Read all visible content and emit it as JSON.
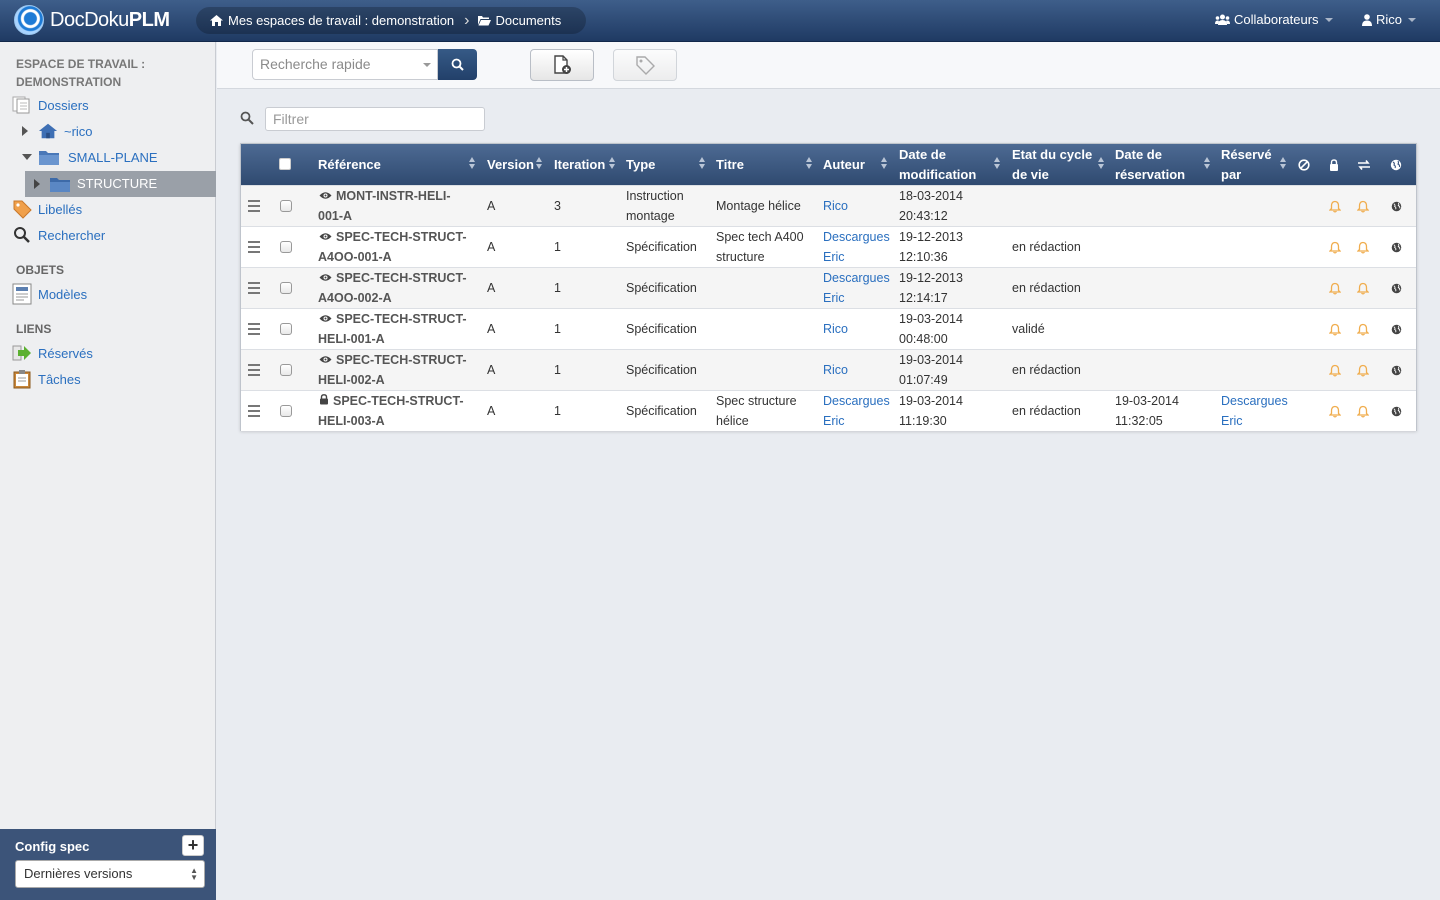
{
  "app": {
    "brand_plain": "DocDoku",
    "brand_bold": "PLM"
  },
  "breadcrumb": {
    "workspace": "Mes espaces de travail : demonstration",
    "documents": "Documents"
  },
  "navbar": {
    "collaborators": "Collaborateurs",
    "user": "Rico"
  },
  "sidebar": {
    "workspace_title": "ESPACE DE TRAVAIL : DEMONSTRATION",
    "folders": "Dossiers",
    "home_folder": "~rico",
    "small_plane": "SMALL-PLANE",
    "structure": "STRUCTURE",
    "tags": "Libellés",
    "search": "Rechercher",
    "objects_section": "OBJETS",
    "models": "Modèles",
    "links_section": "LIENS",
    "reserved": "Réservés",
    "tasks": "Tâches"
  },
  "config": {
    "title": "Config spec",
    "add": "+",
    "selected": "Dernières versions"
  },
  "toolbar": {
    "search_placeholder": "Recherche rapide"
  },
  "filter": {
    "placeholder": "Filtrer"
  },
  "table": {
    "headers": {
      "reference": "Référence",
      "version": "Version",
      "iteration": "Iteration",
      "type": "Type",
      "title": "Titre",
      "author": "Auteur",
      "modified_1": "Date de",
      "modified_2": "modification",
      "lifecycle_1": "Etat du cycle",
      "lifecycle_2": "de vie",
      "reservation_1": "Date de",
      "reservation_2": "réservation",
      "reserved_by_1": "Réservé",
      "reserved_by_2": "par"
    },
    "rows": [
      {
        "status_icon": "eye-icon",
        "ref1": "MONT-INSTR-HELI-",
        "ref2": "001-A",
        "version": "A",
        "iteration": "3",
        "type1": "Instruction",
        "type2": "montage",
        "title1": "Montage hélice",
        "title2": "",
        "author1": "Rico",
        "author2": "",
        "date1": "18-03-2014",
        "date2": "20:43:12",
        "state": "",
        "rdate1": "",
        "rdate2": "",
        "rby1": "",
        "rby2": ""
      },
      {
        "status_icon": "eye-icon",
        "ref1": "SPEC-TECH-STRUCT-",
        "ref2": "A4OO-001-A",
        "version": "A",
        "iteration": "1",
        "type1": "Spécification",
        "type2": "",
        "title1": "Spec tech A400",
        "title2": "structure",
        "author1": "Descargues",
        "author2": "Eric",
        "date1": "19-12-2013",
        "date2": "12:10:36",
        "state": "en rédaction",
        "rdate1": "",
        "rdate2": "",
        "rby1": "",
        "rby2": ""
      },
      {
        "status_icon": "eye-icon",
        "ref1": "SPEC-TECH-STRUCT-",
        "ref2": "A4OO-002-A",
        "version": "A",
        "iteration": "1",
        "type1": "Spécification",
        "type2": "",
        "title1": "",
        "title2": "",
        "author1": "Descargues",
        "author2": "Eric",
        "date1": "19-12-2013",
        "date2": "12:14:17",
        "state": "en rédaction",
        "rdate1": "",
        "rdate2": "",
        "rby1": "",
        "rby2": ""
      },
      {
        "status_icon": "eye-icon",
        "ref1": "SPEC-TECH-STRUCT-",
        "ref2": "HELI-001-A",
        "version": "A",
        "iteration": "1",
        "type1": "Spécification",
        "type2": "",
        "title1": "",
        "title2": "",
        "author1": "Rico",
        "author2": "",
        "date1": "19-03-2014",
        "date2": "00:48:00",
        "state": "validé",
        "rdate1": "",
        "rdate2": "",
        "rby1": "",
        "rby2": ""
      },
      {
        "status_icon": "eye-icon",
        "ref1": "SPEC-TECH-STRUCT-",
        "ref2": "HELI-002-A",
        "version": "A",
        "iteration": "1",
        "type1": "Spécification",
        "type2": "",
        "title1": "",
        "title2": "",
        "author1": "Rico",
        "author2": "",
        "date1": "19-03-2014",
        "date2": "01:07:49",
        "state": "en rédaction",
        "rdate1": "",
        "rdate2": "",
        "rby1": "",
        "rby2": ""
      },
      {
        "status_icon": "lock-icon",
        "ref1": "SPEC-TECH-STRUCT-",
        "ref2": "HELI-003-A",
        "version": "A",
        "iteration": "1",
        "type1": "Spécification",
        "type2": "",
        "title1": "Spec structure",
        "title2": "hélice",
        "author1": "Descargues",
        "author2": "Eric",
        "date1": "19-03-2014",
        "date2": "11:19:30",
        "state": "en rédaction",
        "rdate1": "19-03-2014",
        "rdate2": "11:32:05",
        "rby1": "Descargues",
        "rby2": "Eric"
      }
    ]
  },
  "colors": {
    "navbar": "#2f4a70",
    "link": "#2a6fbf",
    "bell": "#f0ad4e"
  }
}
